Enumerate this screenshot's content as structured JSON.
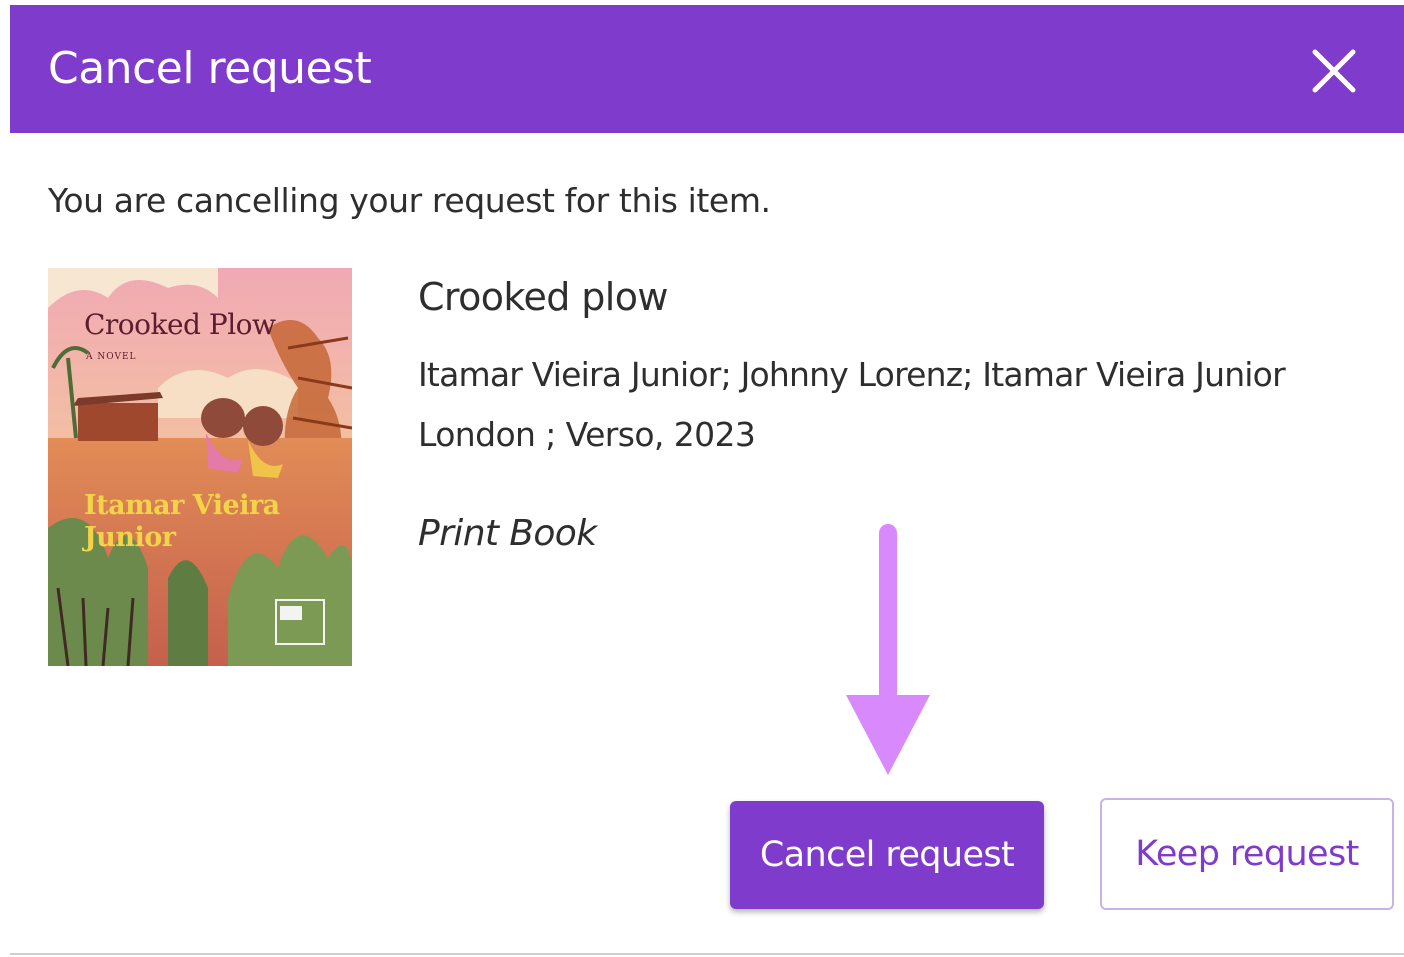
{
  "dialog": {
    "title": "Cancel request",
    "close_icon": "close-icon",
    "intro_text": "You are cancelling your request for this item."
  },
  "item": {
    "cover": {
      "title": "Crooked Plow",
      "subtitle": "A NOVEL",
      "author": "Itamar Vieira Junior"
    },
    "title": "Crooked plow",
    "authors": "Itamar Vieira Junior; Johnny Lorenz; Itamar Vieira Junior",
    "publisher": "London ; Verso, 2023",
    "format": "Print Book"
  },
  "actions": {
    "cancel_label": "Cancel request",
    "keep_label": "Keep request"
  },
  "annotation": {
    "arrow_icon": "arrow-down-icon",
    "arrow_color": "#d88afc"
  },
  "colors": {
    "brand": "#7f3bcb",
    "text": "#2e2e2e",
    "keep_border": "#c9b2e6"
  }
}
